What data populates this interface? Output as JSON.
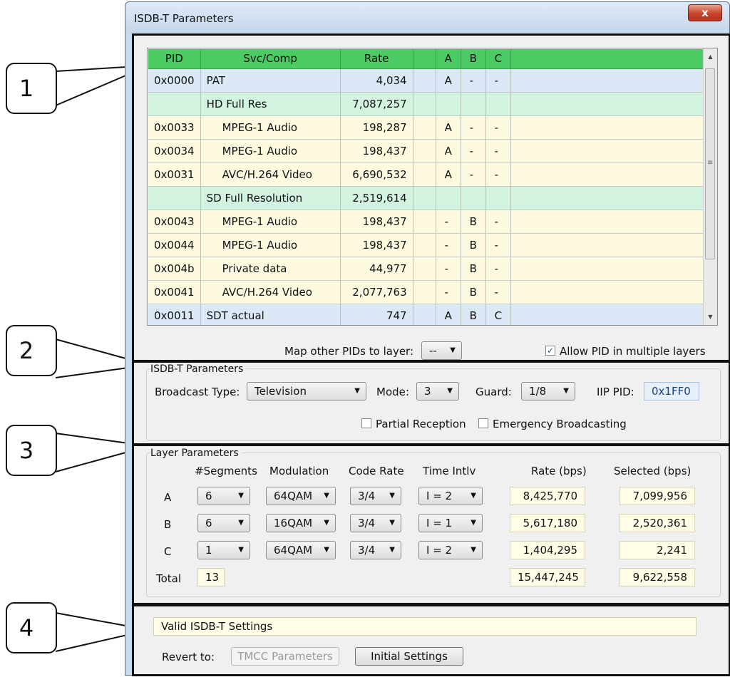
{
  "window": {
    "title": "ISDB-T Parameters",
    "close_glyph": "x"
  },
  "callouts": [
    "1",
    "2",
    "3",
    "4"
  ],
  "grid": {
    "headers": [
      "PID",
      "Svc/Comp",
      "Rate",
      "",
      "A",
      "B",
      "C",
      ""
    ],
    "rows": [
      {
        "type": "pid",
        "pid": "0x0000",
        "name": "PAT",
        "rate": "4,034",
        "a": "A",
        "b": "-",
        "c": "-"
      },
      {
        "type": "svc",
        "pid": "",
        "name": "HD Full Res",
        "rate": "7,087,257",
        "a": "",
        "b": "",
        "c": ""
      },
      {
        "type": "comp",
        "pid": "0x0033",
        "name": "MPEG-1 Audio",
        "rate": "198,287",
        "a": "A",
        "b": "-",
        "c": "-"
      },
      {
        "type": "comp",
        "pid": "0x0034",
        "name": "MPEG-1 Audio",
        "rate": "198,437",
        "a": "A",
        "b": "-",
        "c": "-"
      },
      {
        "type": "comp",
        "pid": "0x0031",
        "name": "AVC/H.264 Video",
        "rate": "6,690,532",
        "a": "A",
        "b": "-",
        "c": "-"
      },
      {
        "type": "svc",
        "pid": "",
        "name": "SD Full Resolution",
        "rate": "2,519,614",
        "a": "",
        "b": "",
        "c": ""
      },
      {
        "type": "comp",
        "pid": "0x0043",
        "name": "MPEG-1 Audio",
        "rate": "198,437",
        "a": "-",
        "b": "B",
        "c": "-"
      },
      {
        "type": "comp",
        "pid": "0x0044",
        "name": "MPEG-1 Audio",
        "rate": "198,437",
        "a": "-",
        "b": "B",
        "c": "-"
      },
      {
        "type": "comp",
        "pid": "0x004b",
        "name": "Private data",
        "rate": "44,977",
        "a": "-",
        "b": "B",
        "c": "-"
      },
      {
        "type": "comp",
        "pid": "0x0041",
        "name": "AVC/H.264 Video",
        "rate": "2,077,763",
        "a": "-",
        "b": "B",
        "c": "-"
      },
      {
        "type": "pid",
        "pid": "0x0011",
        "name": "SDT actual",
        "rate": "747",
        "a": "A",
        "b": "B",
        "c": "C"
      }
    ],
    "map_label": "Map other PIDs to layer:",
    "map_value": "--",
    "allow_multi_label": "Allow PID in multiple layers",
    "allow_multi_checked": "✓"
  },
  "isdbt": {
    "title": "ISDB-T Parameters",
    "broadcast_label": "Broadcast Type:",
    "broadcast_value": "Television",
    "mode_label": "Mode:",
    "mode_value": "3",
    "guard_label": "Guard:",
    "guard_value": "1/8",
    "iip_label": "IIP PID:",
    "iip_value": "0x1FF0",
    "partial_label": "Partial Reception",
    "emergency_label": "Emergency Broadcasting"
  },
  "layers": {
    "title": "Layer Parameters",
    "headers": {
      "segments": "#Segments",
      "modulation": "Modulation",
      "code_rate": "Code Rate",
      "time_intlv": "Time Intlv",
      "rate": "Rate (bps)",
      "selected": "Selected (bps)"
    },
    "rows": [
      {
        "layer": "A",
        "segments": "6",
        "modulation": "64QAM",
        "code_rate": "3/4",
        "time_intlv": "I = 2",
        "rate": "8,425,770",
        "selected": "7,099,956"
      },
      {
        "layer": "B",
        "segments": "6",
        "modulation": "16QAM",
        "code_rate": "3/4",
        "time_intlv": "I = 1",
        "rate": "5,617,180",
        "selected": "2,520,361"
      },
      {
        "layer": "C",
        "segments": "1",
        "modulation": "64QAM",
        "code_rate": "3/4",
        "time_intlv": "I = 2",
        "rate": "1,404,295",
        "selected": "2,241"
      }
    ],
    "total_label": "Total",
    "total_segments": "13",
    "total_rate": "15,447,245",
    "total_selected": "9,622,558"
  },
  "status": {
    "message": "Valid ISDB-T Settings",
    "revert_label": "Revert to:",
    "tmcc_button": "TMCC Parameters",
    "initial_button": "Initial Settings"
  },
  "glyphs": {
    "dropdown": "▼",
    "scroll_up": "▲",
    "scroll_down": "▼",
    "grip": "≡"
  }
}
